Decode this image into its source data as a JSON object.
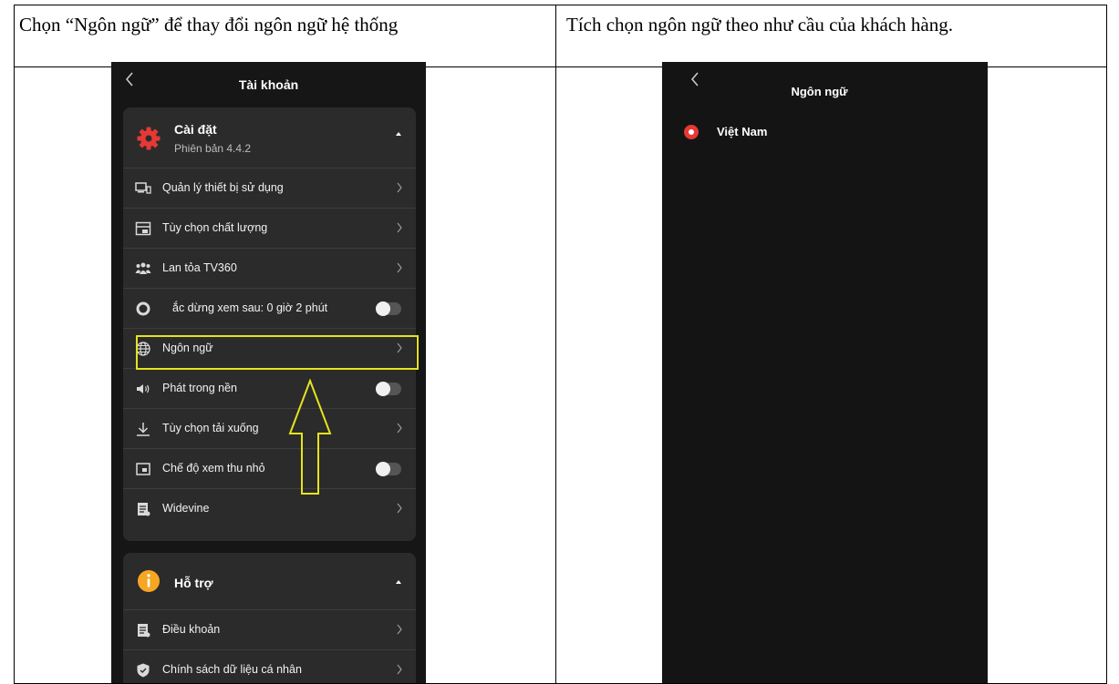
{
  "table": {
    "left_header": "Chọn “Ngôn ngữ” để thay đổi ngôn ngữ hệ thống",
    "right_header": "Tích chọn ngôn ngữ theo như cầu của khách hàng."
  },
  "screen_account": {
    "title": "Tài khoản",
    "settings": {
      "title": "Cài đặt",
      "version": "Phiên bản 4.4.2",
      "items": [
        {
          "label": "Quản lý thiết bị sử dụng",
          "icon": "devices-icon",
          "control": "chevron"
        },
        {
          "label": "Tùy chọn chất lượng",
          "icon": "quality-icon",
          "control": "chevron"
        },
        {
          "label": "Lan tỏa TV360",
          "icon": "group-icon",
          "control": "chevron"
        },
        {
          "label": "ắc dừng xem sau: 0 giờ 2 phút",
          "icon": "timer-icon",
          "control": "toggle",
          "on": false
        },
        {
          "label": "Ngôn ngữ",
          "icon": "globe-icon",
          "control": "chevron"
        },
        {
          "label": "Phát trong nền",
          "icon": "speaker-icon",
          "control": "toggle",
          "on": false
        },
        {
          "label": "Tùy chọn tải xuống",
          "icon": "download-icon",
          "control": "chevron"
        },
        {
          "label": "Chế độ xem thu nhỏ",
          "icon": "pip-icon",
          "control": "toggle",
          "on": false
        },
        {
          "label": "Widevine",
          "icon": "document-icon",
          "control": "chevron"
        }
      ]
    },
    "support": {
      "title": "Hỗ trợ",
      "items": [
        {
          "label": "Điều khoản",
          "icon": "document-icon",
          "control": "chevron"
        },
        {
          "label": "Chính sách dữ liệu cá nhân",
          "icon": "shield-icon",
          "control": "chevron"
        }
      ]
    }
  },
  "screen_language": {
    "title": "Ngôn ngữ",
    "options": [
      {
        "label": "Việt Nam",
        "selected": true
      }
    ]
  },
  "colors": {
    "accent_red": "#e53935",
    "support_orange": "#f5a623",
    "highlight_yellow": "#e6e31d",
    "screen_bg": "#161616",
    "card_bg": "#2b2b2b"
  }
}
